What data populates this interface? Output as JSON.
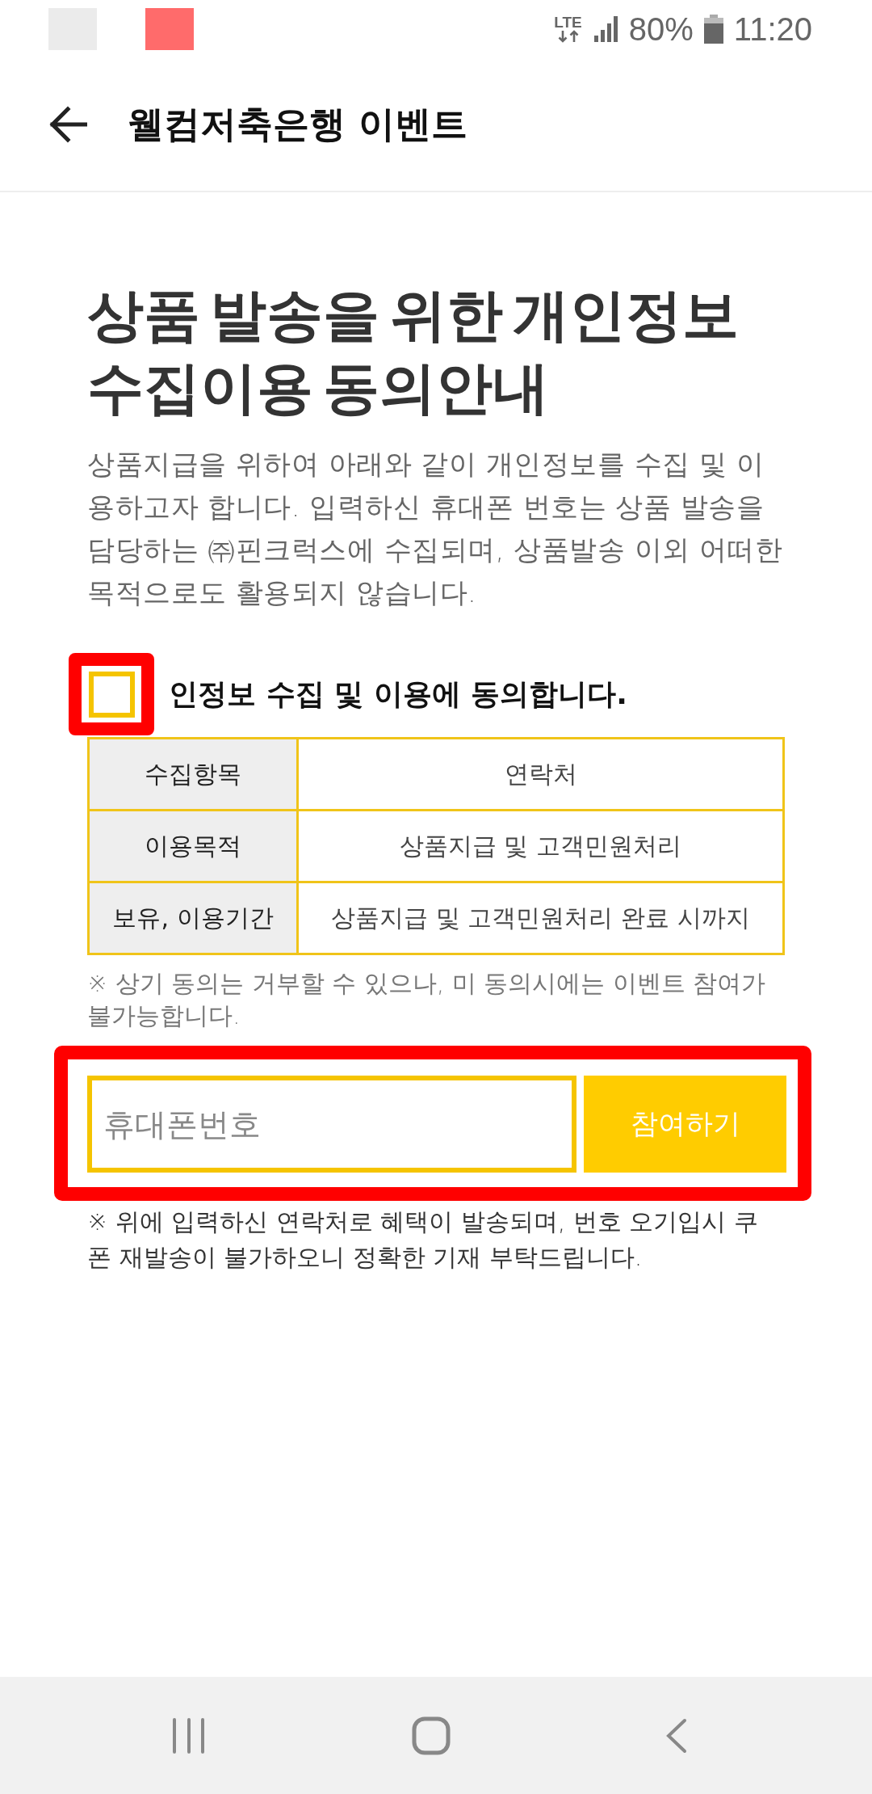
{
  "status_bar": {
    "notifications": [
      {
        "color": "#ebebeb"
      },
      {
        "color": "#ff6b6b"
      }
    ],
    "network_label": "LTE",
    "battery": "80%",
    "time": "11:20"
  },
  "header": {
    "title": "웰컴저축은행 이벤트"
  },
  "heading": "상품 발송을 위한 개인정보 수집이용 동의안내",
  "intro": "상품지급을 위하여 아래와 같이 개인정보를 수집 및 이용하고자 합니다. 입력하신 휴대폰 번호는 상품 발송을 담당하는 ㈜핀크럭스에 수집되며, 상품발송 이외 어떠한 목적으로도 활용되지 않습니다.",
  "agreement": {
    "label": "인정보 수집 및 이용에 동의합니다.",
    "checked": false,
    "highlighted": true
  },
  "table": {
    "rows": [
      {
        "label": "수집항목",
        "value": "연락처"
      },
      {
        "label": "이용목적",
        "value": "상품지급 및 고객민원처리"
      },
      {
        "label": "보유, 이용기간",
        "value": "상품지급 및 고객민원처리 완료 시까지"
      }
    ]
  },
  "notice": "※ 상기 동의는 거부할 수 있으나, 미 동의시에는 이벤트 참여가 불가능합니다.",
  "form": {
    "highlighted": true,
    "phone": {
      "placeholder": "휴대폰번호"
    },
    "submit": "참여하기"
  },
  "footnote": "※ 위에 입력하신 연락처로 혜택이 발송되며, 번호 오기입시 쿠폰 재발송이 불가하오니 정확한 기재 부탁드립니다."
}
